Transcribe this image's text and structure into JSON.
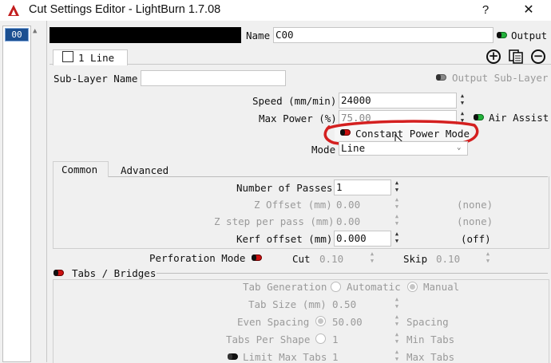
{
  "window": {
    "title": "Cut Settings Editor - LightBurn 1.7.08",
    "help": "?",
    "close": "✕"
  },
  "layer_list": {
    "selected": "00"
  },
  "header": {
    "name_label": "Name",
    "name_value": "C00",
    "output_label": "Output"
  },
  "sublayer": {
    "tab_label": "1 Line",
    "name_label": "Sub-Layer Name",
    "name_value": "",
    "output_sublayer_label": "Output Sub-Layer"
  },
  "speed": {
    "label": "Speed (mm/min)",
    "value": "24000"
  },
  "power": {
    "label": "Max Power (%)",
    "value": "75.00",
    "air_assist_label": "Air Assist"
  },
  "constant_power": {
    "label": "Constant Power Mode"
  },
  "mode": {
    "label": "Mode",
    "value": "Line"
  },
  "tabs": {
    "common": "Common",
    "advanced": "Advanced"
  },
  "passes": {
    "label": "Number of Passes",
    "value": "1"
  },
  "z_offset": {
    "label": "Z Offset (mm)",
    "value": "0.00",
    "note": "(none)"
  },
  "z_step": {
    "label": "Z step per pass (mm)",
    "value": "0.00",
    "note": "(none)"
  },
  "kerf": {
    "label": "Kerf offset (mm)",
    "value": "0.000",
    "note": "(off)"
  },
  "perforation": {
    "label": "Perforation Mode",
    "cut_label": "Cut",
    "cut_value": "0.10",
    "skip_label": "Skip",
    "skip_value": "0.10"
  },
  "tabs_bridges": {
    "label": "Tabs / Bridges",
    "generation_label": "Tab Generation",
    "automatic_label": "Automatic",
    "manual_label": "Manual",
    "size_label": "Tab Size (mm)",
    "size_value": "0.50",
    "even_spacing_label": "Even Spacing",
    "even_spacing_value": "50.00",
    "spacing_label": "Spacing",
    "per_shape_label": "Tabs Per Shape",
    "per_shape_value": "1",
    "min_tabs_label": "Min Tabs",
    "limit_label": "Limit Max Tabs",
    "limit_value": "1",
    "max_tabs_label": "Max Tabs"
  },
  "colors": {
    "accent_red": "#d42020",
    "layer_blue": "#1b4f91",
    "toggle_green": "#22b13b"
  }
}
